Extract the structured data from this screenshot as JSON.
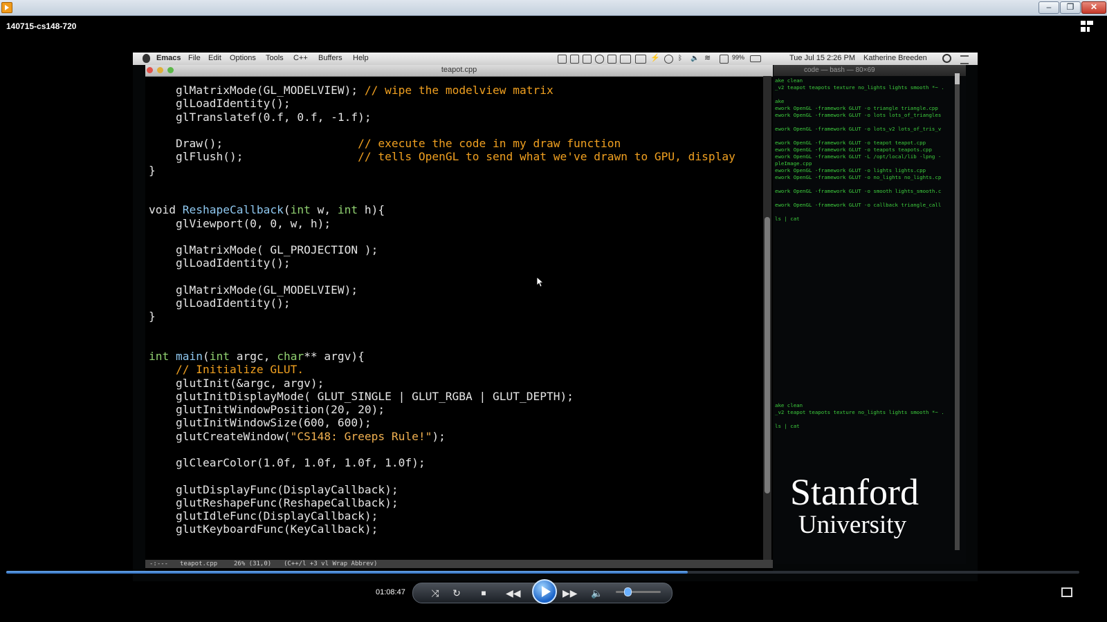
{
  "window": {
    "title": "",
    "minimize_label": "–",
    "maximize_label": "❐",
    "close_label": "✕"
  },
  "video_title": "140715-cs148-720",
  "mac_menubar": {
    "app": "Emacs",
    "menus": [
      "File",
      "Edit",
      "Options",
      "Tools",
      "C++",
      "Buffers",
      "Help"
    ],
    "battery": "99%",
    "datetime": "Tue Jul 15  2:26 PM",
    "user": "Katherine Breeden"
  },
  "emacs": {
    "filename": "teapot.cpp",
    "code_lines": [
      [
        [
          "    glMatrixMode(GL_MODELVIEW); ",
          ""
        ],
        [
          "// wipe the modelview matrix",
          "cm"
        ]
      ],
      [
        [
          "    glLoadIdentity();",
          ""
        ]
      ],
      [
        [
          "    glTranslatef(0.f, 0.f, -1.f);",
          ""
        ]
      ],
      [
        [
          "",
          ""
        ]
      ],
      [
        [
          "    Draw();                    ",
          ""
        ],
        [
          "// execute the code in my draw function",
          "cm"
        ]
      ],
      [
        [
          "    glFlush();                 ",
          ""
        ],
        [
          "// tells OpenGL to send what we've drawn to GPU, display",
          "cm"
        ]
      ],
      [
        [
          "}",
          ""
        ]
      ],
      [
        [
          "",
          ""
        ]
      ],
      [
        [
          "",
          ""
        ]
      ],
      [
        [
          "void ",
          "kw"
        ],
        [
          "ReshapeCallback",
          "fn"
        ],
        [
          "(",
          ""
        ],
        [
          "int",
          "ty"
        ],
        [
          " w, ",
          ""
        ],
        [
          "int",
          "ty"
        ],
        [
          " h){",
          ""
        ]
      ],
      [
        [
          "    glViewport(0, 0, w, h);",
          ""
        ]
      ],
      [
        [
          "",
          ""
        ]
      ],
      [
        [
          "    glMatrixMode( GL_PROJECTION );",
          ""
        ]
      ],
      [
        [
          "    glLoadIdentity();",
          ""
        ]
      ],
      [
        [
          "",
          ""
        ]
      ],
      [
        [
          "    glMatrixMode(GL_MODELVIEW);",
          ""
        ]
      ],
      [
        [
          "    glLoadIdentity();",
          ""
        ]
      ],
      [
        [
          "}",
          ""
        ]
      ],
      [
        [
          "",
          ""
        ]
      ],
      [
        [
          "",
          ""
        ]
      ],
      [
        [
          "int ",
          "ty"
        ],
        [
          "main",
          "fn"
        ],
        [
          "(",
          ""
        ],
        [
          "int",
          "ty"
        ],
        [
          " argc, ",
          ""
        ],
        [
          "char",
          "ty"
        ],
        [
          "** argv){",
          ""
        ]
      ],
      [
        [
          "    ",
          ""
        ],
        [
          "// Initialize GLUT.",
          "cm"
        ]
      ],
      [
        [
          "    glutInit(&argc, argv);",
          ""
        ]
      ],
      [
        [
          "    glutInitDisplayMode( GLUT_SINGLE | GLUT_RGBA | GLUT_DEPTH);",
          ""
        ]
      ],
      [
        [
          "    glutInitWindowPosition(20, 20);",
          ""
        ]
      ],
      [
        [
          "    glutInitWindowSize(600, 600);",
          ""
        ]
      ],
      [
        [
          "    glutCreateWindow(",
          ""
        ],
        [
          "\"CS148: Greeps Rule!\"",
          "st"
        ],
        [
          ");",
          ""
        ]
      ],
      [
        [
          "",
          ""
        ]
      ],
      [
        [
          "    glClearColor(1.0f, 1.0f, 1.0f, 1.0f);",
          ""
        ]
      ],
      [
        [
          "",
          ""
        ]
      ],
      [
        [
          "    glutDisplayFunc(DisplayCallback);",
          ""
        ]
      ],
      [
        [
          "    glutReshapeFunc(ReshapeCallback);",
          ""
        ]
      ],
      [
        [
          "    glutIdleFunc(DisplayCallback);",
          ""
        ]
      ],
      [
        [
          "    glutKeyboardFunc(KeyCallback);",
          ""
        ]
      ]
    ],
    "modeline": {
      "flags": "-:---",
      "buffer": "teapot.cpp",
      "position": "26% (31,0)",
      "modes": "(C++/l +3 vl Wrap Abbrev)"
    }
  },
  "terminal": {
    "title": "code — bash — 80×69",
    "lines": [
      {
        "row": 0,
        "text": "ake clean"
      },
      {
        "row": 1,
        "text": "_v2 teapot teapots texture no_lights lights smooth *~ ."
      },
      {
        "row": 3,
        "text": "ake"
      },
      {
        "row": 4,
        "text": "ework OpenGL -framework GLUT -o triangle triangle.cpp"
      },
      {
        "row": 5,
        "text": "ework OpenGL -framework GLUT -o lots lots_of_triangles"
      },
      {
        "row": 7,
        "text": "ework OpenGL -framework GLUT -o lots_v2 lots_of_tris_v"
      },
      {
        "row": 9,
        "text": "ework OpenGL -framework GLUT -o teapot teapot.cpp"
      },
      {
        "row": 10,
        "text": "ework OpenGL -framework GLUT -o teapots teapots.cpp"
      },
      {
        "row": 11,
        "text": "ework OpenGL -framework GLUT -L /opt/local/lib -lpng -"
      },
      {
        "row": 12,
        "text": "pleImage.cpp"
      },
      {
        "row": 13,
        "text": "ework OpenGL -framework GLUT -o lights lights.cpp"
      },
      {
        "row": 14,
        "text": "ework OpenGL -framework GLUT -o no_lights no_lights.cp"
      },
      {
        "row": 16,
        "text": "ework OpenGL -framework GLUT -o smooth lights_smooth.c"
      },
      {
        "row": 18,
        "text": "ework OpenGL -framework GLUT -o callback triangle_call"
      },
      {
        "row": 20,
        "text": "ls | cat"
      },
      {
        "row": 47,
        "text": "ake clean"
      },
      {
        "row": 48,
        "text": "_v2 teapot teapots texture no_lights lights smooth *~ ."
      },
      {
        "row": 50,
        "text": "ls | cat"
      }
    ]
  },
  "watermark": {
    "line1": "Stanford",
    "line2": "University"
  },
  "player": {
    "timecode": "01:08:47",
    "progress": 0.635,
    "volume": 0.25
  }
}
